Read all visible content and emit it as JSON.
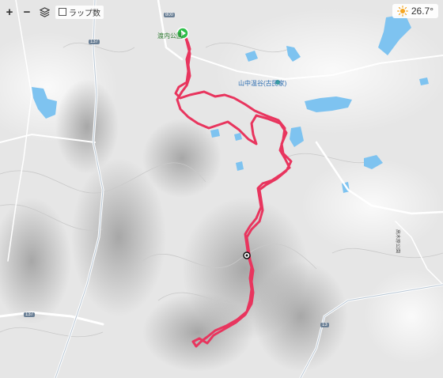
{
  "toolbar": {
    "zoom_in": "+",
    "zoom_out": "−",
    "layers_icon": "layers-icon",
    "map_label": "ラップ数"
  },
  "weather": {
    "temperature": "26.7°",
    "icon": "sun-icon",
    "icon_color": "#f5a623"
  },
  "places": {
    "start_park": "渡内公園",
    "poi_name": "山中温谷(古民家)",
    "local_name": "高木原公園"
  },
  "road_numbers": [
    "800",
    "137",
    "137",
    "13"
  ],
  "colors": {
    "track": "#e8355e",
    "water": "#7ec3f0",
    "start_marker": "#2fbf4a"
  }
}
